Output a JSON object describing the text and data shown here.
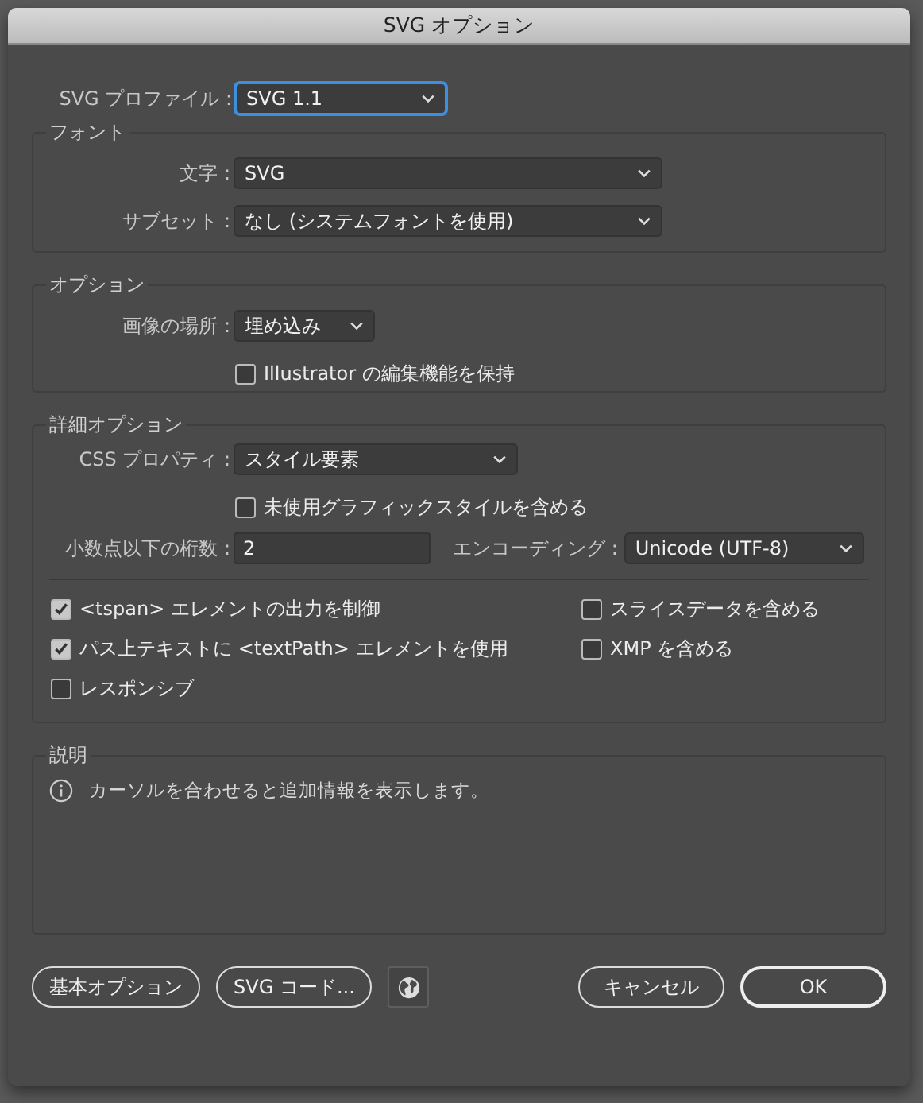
{
  "window": {
    "title": "SVG オプション"
  },
  "profile": {
    "label": "SVG プロファイル :",
    "value": "SVG 1.1",
    "focused": true
  },
  "font_group": {
    "title": "フォント",
    "rows": [
      {
        "label": "文字 :",
        "value": "SVG"
      },
      {
        "label": "サブセット :",
        "value": "なし (システムフォントを使用)"
      }
    ]
  },
  "options_group": {
    "title": "オプション",
    "image_location": {
      "label": "画像の場所 :",
      "value": "埋め込み"
    },
    "preserve_editing": {
      "label": "Illustrator の編集機能を保持",
      "checked": false
    }
  },
  "advanced_group": {
    "title": "詳細オプション",
    "css_properties": {
      "label": "CSS プロパティ :",
      "value": "スタイル要素"
    },
    "include_unused": {
      "label": "未使用グラフィックスタイルを含める",
      "checked": false
    },
    "decimal_places": {
      "label": "小数点以下の桁数 :",
      "value": "2"
    },
    "encoding": {
      "label": "エンコーディング :",
      "value": "Unicode (UTF-8)"
    },
    "checkboxes": [
      {
        "label": "<tspan> エレメントの出力を制御",
        "checked": true
      },
      {
        "label": "スライスデータを含める",
        "checked": false
      },
      {
        "label": "パス上テキストに <textPath> エレメントを使用",
        "checked": true
      },
      {
        "label": "XMP を含める",
        "checked": false
      },
      {
        "label": "レスポンシブ",
        "checked": false
      }
    ]
  },
  "description_group": {
    "title": "説明",
    "text": "カーソルを合わせると追加情報を表示します。"
  },
  "left_buttons": [
    {
      "kind": "text",
      "label": "基本オプション",
      "default": false
    },
    {
      "kind": "text",
      "label": "SVG コード...",
      "default": false
    },
    {
      "kind": "globe",
      "default": false
    }
  ],
  "right_buttons": [
    {
      "kind": "text",
      "label": "キャンセル",
      "default": false
    },
    {
      "kind": "text",
      "label": "OK",
      "default": true
    }
  ]
}
